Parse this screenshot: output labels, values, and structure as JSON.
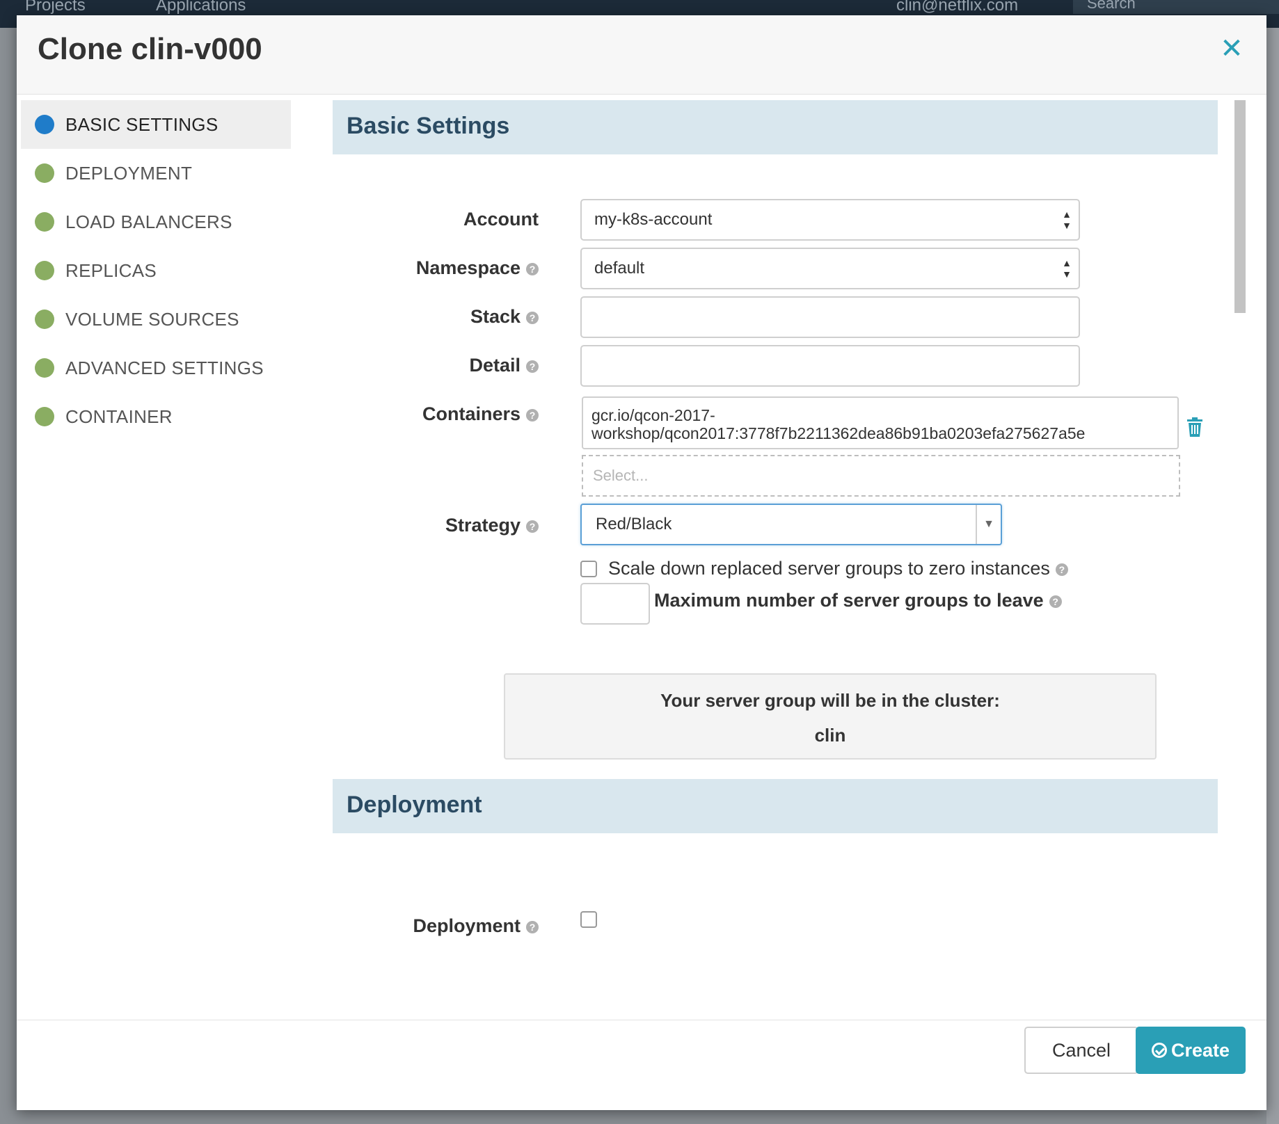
{
  "background": {
    "nav_items": [
      "Projects",
      "Applications"
    ],
    "user_menu": "clin@netflix.com",
    "search_placeholder": "Search"
  },
  "modal": {
    "title": "Clone clin-v000",
    "close_icon": "close-icon"
  },
  "sidebar": {
    "items": [
      {
        "label": "BASIC SETTINGS",
        "active": true,
        "dot_color": "#1f7cc9"
      },
      {
        "label": "DEPLOYMENT",
        "active": false,
        "dot_color": "#8aad62"
      },
      {
        "label": "LOAD BALANCERS",
        "active": false,
        "dot_color": "#8aad62"
      },
      {
        "label": "REPLICAS",
        "active": false,
        "dot_color": "#8aad62"
      },
      {
        "label": "VOLUME SOURCES",
        "active": false,
        "dot_color": "#8aad62"
      },
      {
        "label": "ADVANCED SETTINGS",
        "active": false,
        "dot_color": "#8aad62"
      },
      {
        "label": "CONTAINER",
        "active": false,
        "dot_color": "#8aad62"
      }
    ]
  },
  "basic_settings": {
    "section_title": "Basic Settings",
    "account": {
      "label": "Account",
      "value": "my-k8s-account"
    },
    "namespace": {
      "label": "Namespace",
      "value": "default"
    },
    "stack": {
      "label": "Stack",
      "value": ""
    },
    "detail": {
      "label": "Detail",
      "value": ""
    },
    "containers": {
      "label": "Containers",
      "value_line1": "gcr.io/qcon-2017-",
      "value_line2": "workshop/qcon2017:3778f7b2211362dea86b91ba0203efa275627a5e",
      "select_placeholder": "Select..."
    },
    "strategy": {
      "label": "Strategy",
      "value": "Red/Black"
    },
    "scale_down": {
      "label": "Scale down replaced server groups to zero instances",
      "checked": false
    },
    "max_groups": {
      "label": "Maximum number of server groups to leave",
      "value": ""
    },
    "cluster_info": {
      "line1": "Your server group will be in the cluster:",
      "cluster": "clin"
    }
  },
  "deployment_section": {
    "section_title": "Deployment",
    "deployment": {
      "label": "Deployment",
      "checked": false
    }
  },
  "footer": {
    "cancel_label": "Cancel",
    "create_label": "Create"
  },
  "colors": {
    "accent": "#2a9fb6",
    "section_header_bg": "#d9e7ee",
    "active_dot": "#1f7cc9",
    "inactive_dot": "#8aad62"
  }
}
